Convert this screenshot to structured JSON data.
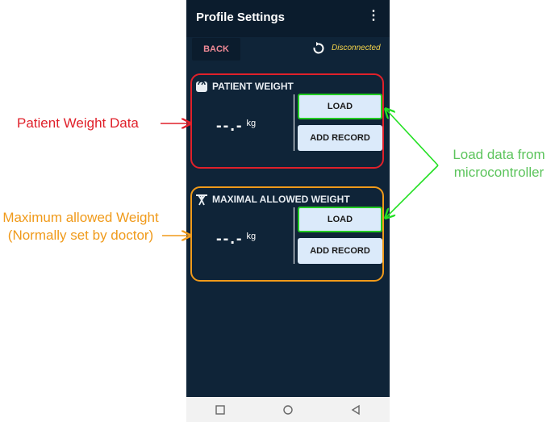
{
  "app": {
    "title": "Profile Settings",
    "menu_icon": "kebab-menu-icon"
  },
  "toolbar": {
    "back_label": "BACK",
    "refresh_icon": "refresh-icon",
    "status": "Disconnected",
    "status_color": "#f6d44a"
  },
  "cards": [
    {
      "heading": "PATIENT WEIGHT",
      "icon": "scale-icon",
      "value": "--.-",
      "unit": "kg",
      "load_label": "LOAD",
      "add_label": "ADD RECORD",
      "border_color": "#e0202a"
    },
    {
      "heading": "MAXIMAL ALLOWED WEIGHT",
      "icon": "weightlifter-icon",
      "value": "--.-",
      "unit": "kg",
      "load_label": "LOAD",
      "add_label": "ADD RECORD",
      "border_color": "#f09a1a"
    }
  ],
  "navbar": {
    "icons": [
      "recents-square-icon",
      "home-circle-icon",
      "back-triangle-icon"
    ]
  },
  "annotations": {
    "patient_weight": "Patient Weight Data",
    "max_weight": "Maximum allowed Weight (Normally set by doctor)",
    "load_data": "Load data from microcontroller"
  },
  "colors": {
    "background": "#0f2438",
    "appbar": "#0b1c2d",
    "button": "#dbeafa",
    "highlight_green": "#22cc22",
    "annotation_red": "#e0202a",
    "annotation_orange": "#f09a1a",
    "annotation_green": "#5cc45c"
  }
}
